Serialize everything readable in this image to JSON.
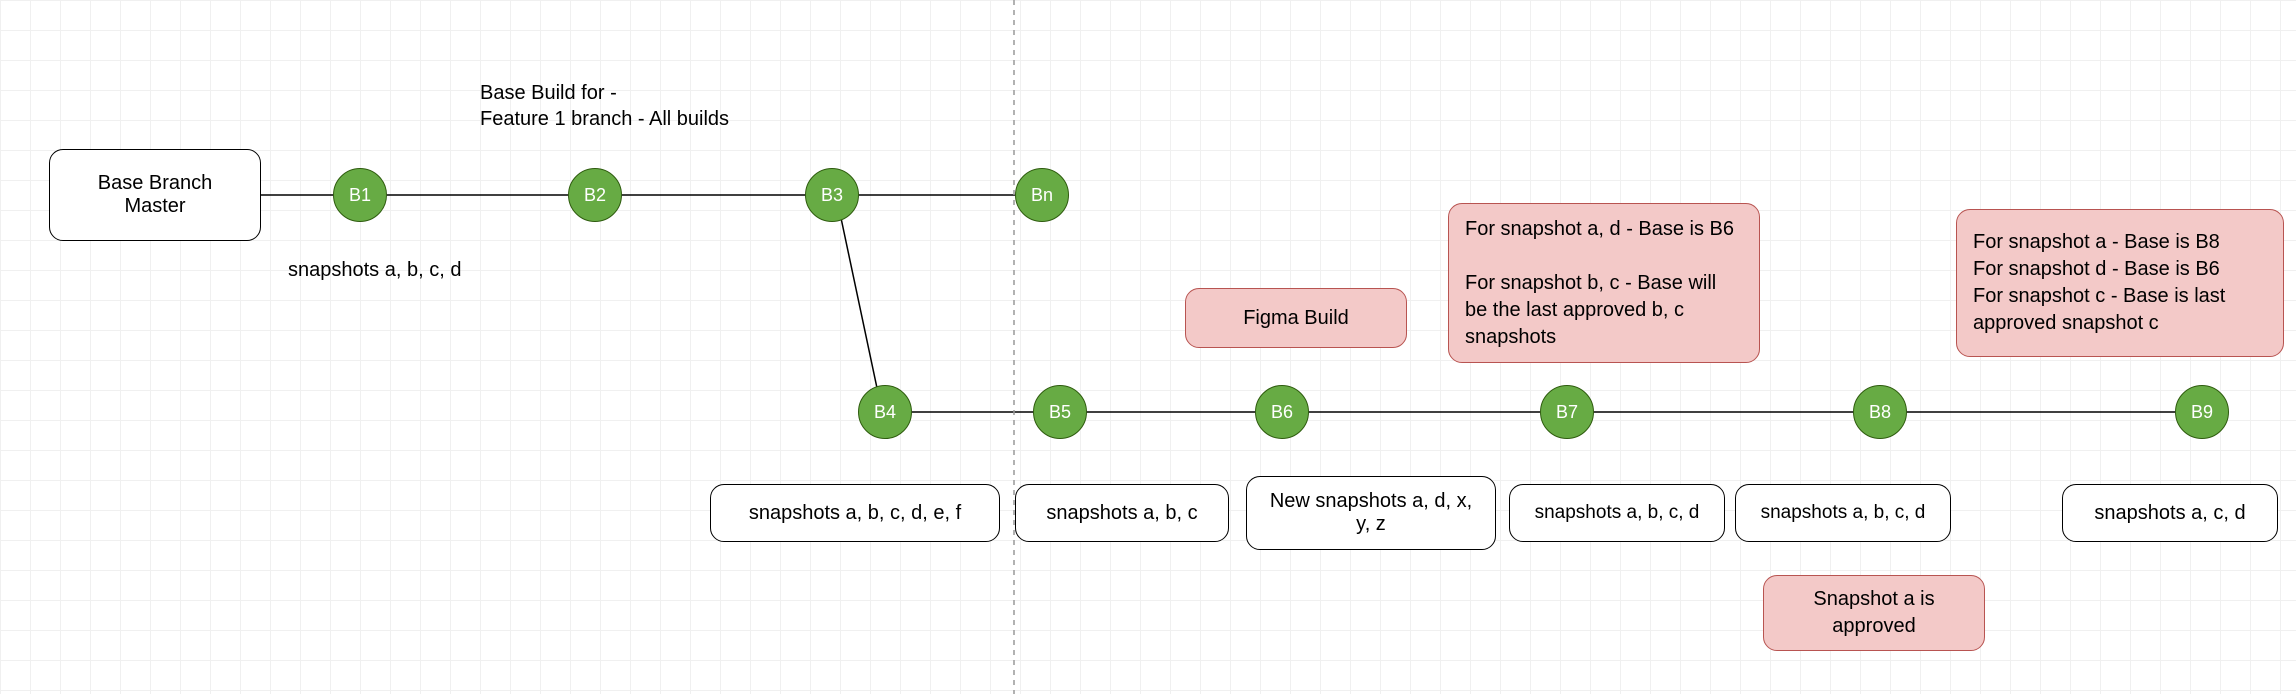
{
  "rootBox": {
    "line1": "Base Branch",
    "line2": "Master"
  },
  "topLabel": "Base Build for -\nFeature 1 branch - All builds",
  "snapshotsLabel": "snapshots a, b, c, d",
  "builds": {
    "b1": "B1",
    "b2": "B2",
    "b3": "B3",
    "bn": "Bn",
    "b4": "B4",
    "b5": "B5",
    "b6": "B6",
    "b7": "B7",
    "b8": "B8",
    "b9": "B9"
  },
  "lowerBoxes": {
    "b4": "snapshots a, b, c, d, e, f",
    "b5": "snapshots a, b, c",
    "b6": "New snapshots a, d, x, y, z",
    "b7": "snapshots a, b, c, d",
    "b8": "snapshots a, b, c, d",
    "b9": "snapshots a, c, d"
  },
  "pink": {
    "figma": "Figma Build",
    "b7note": "For snapshot a, d - Base is B6\n\nFor snapshot b, c - Base will be the last approved b, c snapshots",
    "b8note": "Snapshot a is approved",
    "b9note": "For snapshot a - Base is B8\nFor snapshot d - Base is B6\nFor snapshot c - Base is last approved snapshot c"
  }
}
